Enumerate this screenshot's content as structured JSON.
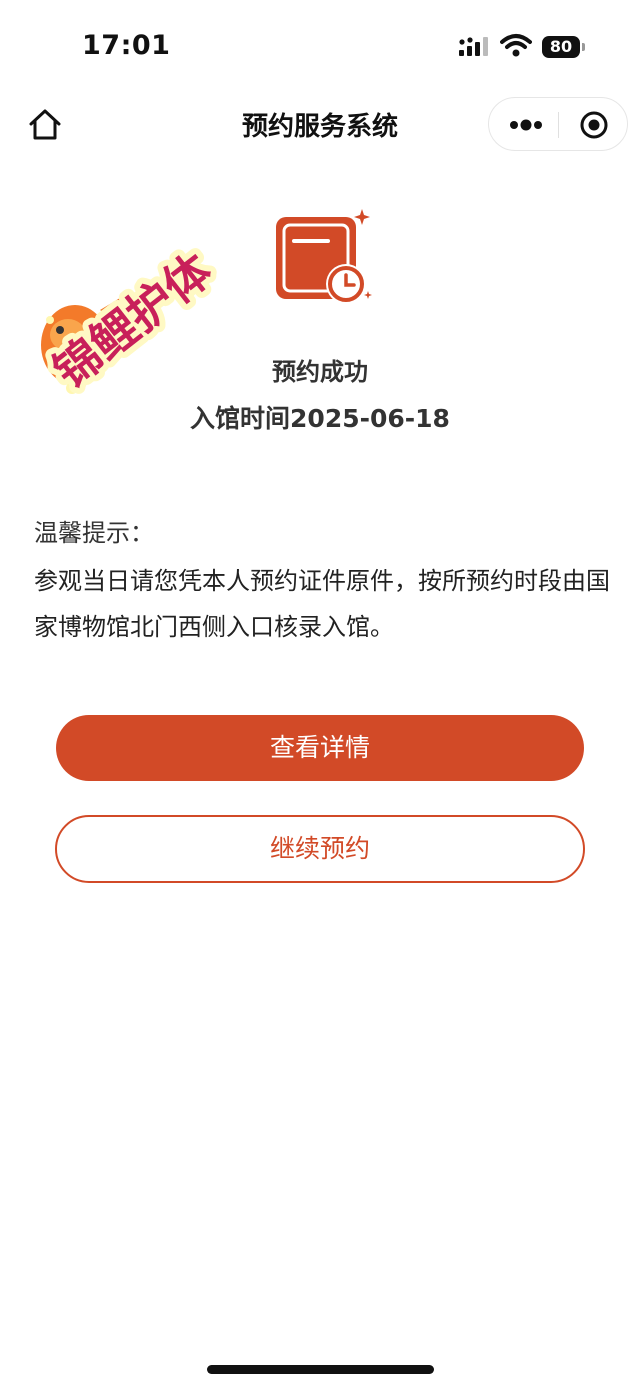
{
  "status_bar": {
    "time": "17:01",
    "battery": "80"
  },
  "nav": {
    "title": "预约服务系统"
  },
  "sticker": {
    "text": "锦鲤护体"
  },
  "result": {
    "title": "预约成功",
    "entry_time": "入馆时间2025-06-18"
  },
  "tips": {
    "heading": "温馨提示：",
    "body": "参观当日请您凭本人预约证件原件，按所预约时段由国家博物馆北门西侧入口核录入馆。"
  },
  "buttons": {
    "details": "查看详情",
    "continue": "继续预约"
  },
  "colors": {
    "accent": "#d24a27"
  }
}
